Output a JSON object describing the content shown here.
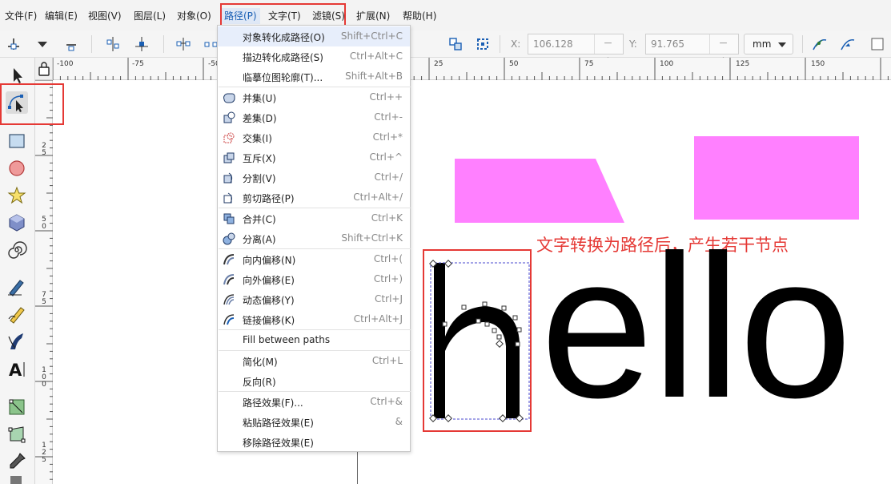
{
  "menubar": {
    "items": [
      {
        "label": "文件(F)"
      },
      {
        "label": "编辑(E)"
      },
      {
        "label": "视图(V)"
      },
      {
        "label": "图层(L)"
      },
      {
        "label": "对象(O)"
      },
      {
        "label": "路径(P)"
      },
      {
        "label": "文字(T)"
      },
      {
        "label": "滤镜(S)"
      },
      {
        "label": "扩展(N)"
      },
      {
        "label": "帮助(H)"
      }
    ]
  },
  "toolbar": {
    "x_label": "X:",
    "x_value": "106.128",
    "y_label": "Y:",
    "y_value": "91.765",
    "unit": "mm",
    "plus_minus": "−+"
  },
  "ruler": {
    "h_labels": [
      "-100",
      "-75",
      "-50",
      "25",
      "50",
      "75",
      "100",
      "125",
      "150"
    ],
    "v_labels": [
      "2",
      "5",
      "5",
      "0",
      "7",
      "5",
      "1",
      "0",
      "0",
      "1",
      "2",
      "5"
    ]
  },
  "path_menu": {
    "items": [
      {
        "label": "对象转化成路径(O)",
        "shortcut": "Shift+Ctrl+C"
      },
      {
        "label": "描边转化成路径(S)",
        "shortcut": "Ctrl+Alt+C"
      },
      {
        "label": "临摹位图轮廓(T)...",
        "shortcut": "Shift+Alt+B"
      },
      {
        "label": "并集(U)",
        "shortcut": "Ctrl++"
      },
      {
        "label": "差集(D)",
        "shortcut": "Ctrl+-"
      },
      {
        "label": "交集(I)",
        "shortcut": "Ctrl+*"
      },
      {
        "label": "互斥(X)",
        "shortcut": "Ctrl+^"
      },
      {
        "label": "分割(V)",
        "shortcut": "Ctrl+/"
      },
      {
        "label": "剪切路径(P)",
        "shortcut": "Ctrl+Alt+/"
      },
      {
        "label": "合并(C)",
        "shortcut": "Ctrl+K"
      },
      {
        "label": "分离(A)",
        "shortcut": "Shift+Ctrl+K"
      },
      {
        "label": "向内偏移(N)",
        "shortcut": "Ctrl+("
      },
      {
        "label": "向外偏移(E)",
        "shortcut": "Ctrl+)"
      },
      {
        "label": "动态偏移(Y)",
        "shortcut": "Ctrl+J"
      },
      {
        "label": "链接偏移(K)",
        "shortcut": "Ctrl+Alt+J"
      },
      {
        "label": "Fill between paths",
        "shortcut": ""
      },
      {
        "label": "简化(M)",
        "shortcut": "Ctrl+L"
      },
      {
        "label": "反向(R)",
        "shortcut": ""
      },
      {
        "label": "路径效果(F)...",
        "shortcut": "Ctrl+&"
      },
      {
        "label": "粘贴路径效果(E)",
        "shortcut": "&"
      },
      {
        "label": "移除路径效果(E)",
        "shortcut": ""
      }
    ]
  },
  "canvas": {
    "annotation": "文字转换为路径后，产生若干节点",
    "hello_rest": "ello",
    "shape_color": "#ff80ff",
    "highlight_color": "#e53935"
  }
}
